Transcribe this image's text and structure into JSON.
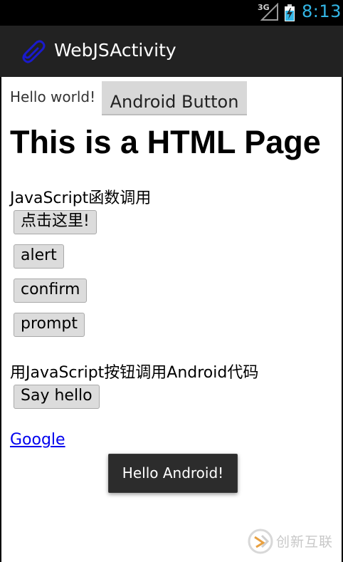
{
  "status_bar": {
    "network": "3G",
    "time": "8:13",
    "time_color": "#33b5e5"
  },
  "action_bar": {
    "title": "WebJSActivity",
    "icon": "paperclip-icon",
    "icon_color": "#1a1acc"
  },
  "native": {
    "hello_text": "Hello world!",
    "android_button_label": "Android Button"
  },
  "web": {
    "heading": "This is a HTML Page",
    "js_section_label": "JavaScript函数调用",
    "buttons": [
      {
        "label": "点击这里!"
      },
      {
        "label": "alert"
      },
      {
        "label": "confirm"
      },
      {
        "label": "prompt"
      }
    ],
    "android_section_label": "用JavaScript按钮调用Android代码",
    "say_hello_label": "Say hello",
    "link_label": "Google"
  },
  "toast": {
    "text": "Hello Android!"
  },
  "watermark": {
    "text": "创新互联"
  }
}
